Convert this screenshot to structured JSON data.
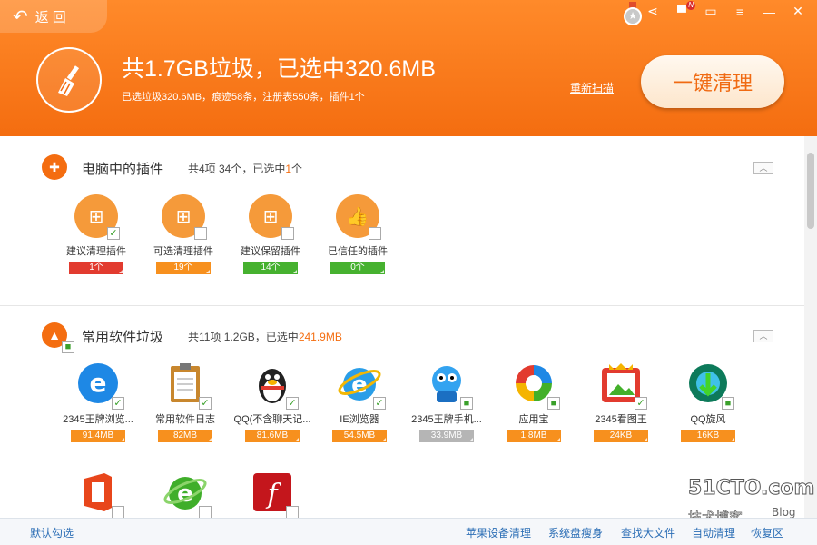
{
  "header": {
    "back_label": "返回",
    "headline": "共1.7GB垃圾，已选中320.6MB",
    "subline": "已选垃圾320.6MB，痕迹58条，注册表550条，插件1个",
    "rescan_label": "重新扫描",
    "clean_button_label": "一键清理",
    "top_icons": [
      "medal-icon",
      "share-icon",
      "skin-icon",
      "message-icon",
      "menu-icon",
      "minimize-icon",
      "close-icon"
    ],
    "notification_badge": "N",
    "brand_color": "#f46d10"
  },
  "plugins_section": {
    "title": "电脑中的插件",
    "stats_prefix": "共4项 34个，已选中",
    "stats_highlight": "1",
    "stats_suffix": "个",
    "collapse_label": "︿",
    "items": [
      {
        "label": "建议清理插件",
        "count": "1个",
        "color": "red",
        "checked": true
      },
      {
        "label": "可选清理插件",
        "count": "19个",
        "color": "orange",
        "checked": false
      },
      {
        "label": "建议保留插件",
        "count": "14个",
        "color": "green",
        "checked": false
      },
      {
        "label": "已信任的插件",
        "count": "0个",
        "color": "green",
        "checked": false
      }
    ]
  },
  "software_section": {
    "title": "常用软件垃圾",
    "stats_prefix": "共11项 1.2GB，已选中",
    "stats_highlight": "241.9MB",
    "collapse_label": "︿",
    "items": [
      {
        "label": "2345王牌浏览...",
        "size": "91.4MB",
        "color": "orange",
        "checked": true
      },
      {
        "label": "常用软件日志",
        "size": "82MB",
        "color": "orange",
        "checked": true
      },
      {
        "label": "QQ(不含聊天记...",
        "size": "81.6MB",
        "color": "orange",
        "checked": true
      },
      {
        "label": "IE浏览器",
        "size": "54.5MB",
        "color": "orange",
        "checked": true
      },
      {
        "label": "2345王牌手机...",
        "size": "33.9MB",
        "color": "gray",
        "checked": true
      },
      {
        "label": "应用宝",
        "size": "1.8MB",
        "color": "orange",
        "checked": true
      },
      {
        "label": "2345看图王",
        "size": "24KB",
        "color": "orange",
        "checked": true
      },
      {
        "label": "QQ旋风",
        "size": "16KB",
        "color": "orange",
        "checked": true
      }
    ],
    "row2_icons": [
      "office-icon",
      "browser-e-icon",
      "flash-icon"
    ]
  },
  "footer": {
    "default_select": "默认勾选",
    "links": [
      "苹果设备清理",
      "系统盘瘦身",
      "查找大文件",
      "自动清理",
      "恢复区"
    ]
  },
  "watermark": {
    "line1": "51CTO.com",
    "line2": "技术博客",
    "line3": "Blog"
  }
}
